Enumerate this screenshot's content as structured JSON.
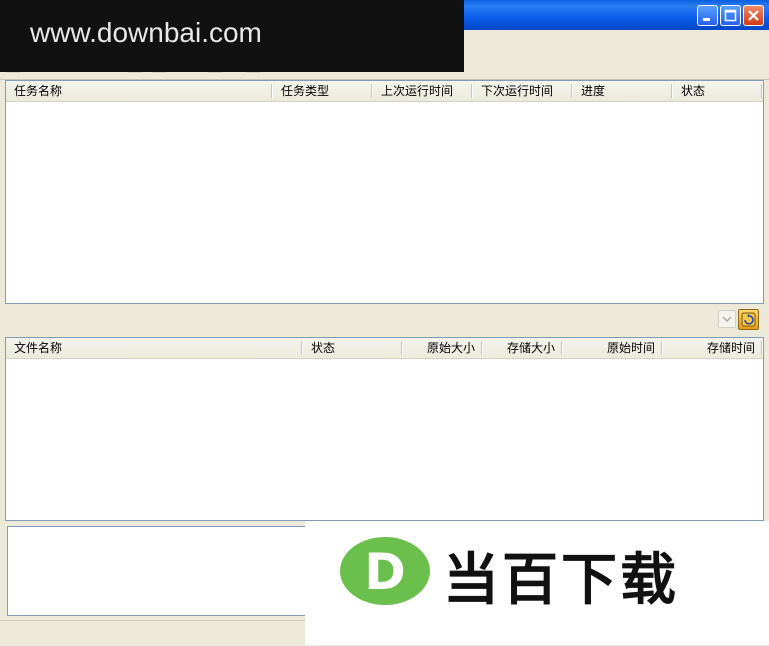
{
  "watermark_top": {
    "text": "www.downbai.com"
  },
  "watermark_logo": {
    "letter": "D",
    "text": "当百下载"
  },
  "title_bar": {
    "buttons": [
      "minimize",
      "maximize",
      "close"
    ]
  },
  "task_list": {
    "columns": [
      "任务名称",
      "任务类型",
      "上次运行时间",
      "下次运行时间",
      "进度",
      "状态"
    ]
  },
  "file_list": {
    "columns": [
      "文件名称",
      "状态",
      "原始大小",
      "存储大小",
      "原始时间",
      "存储时间"
    ]
  },
  "icons": {
    "refresh": "refresh-icon",
    "dropdown": "chevron-down-icon"
  },
  "colors": {
    "titlebar": "#0a5de8",
    "logo_green": "#6bbf4c"
  }
}
